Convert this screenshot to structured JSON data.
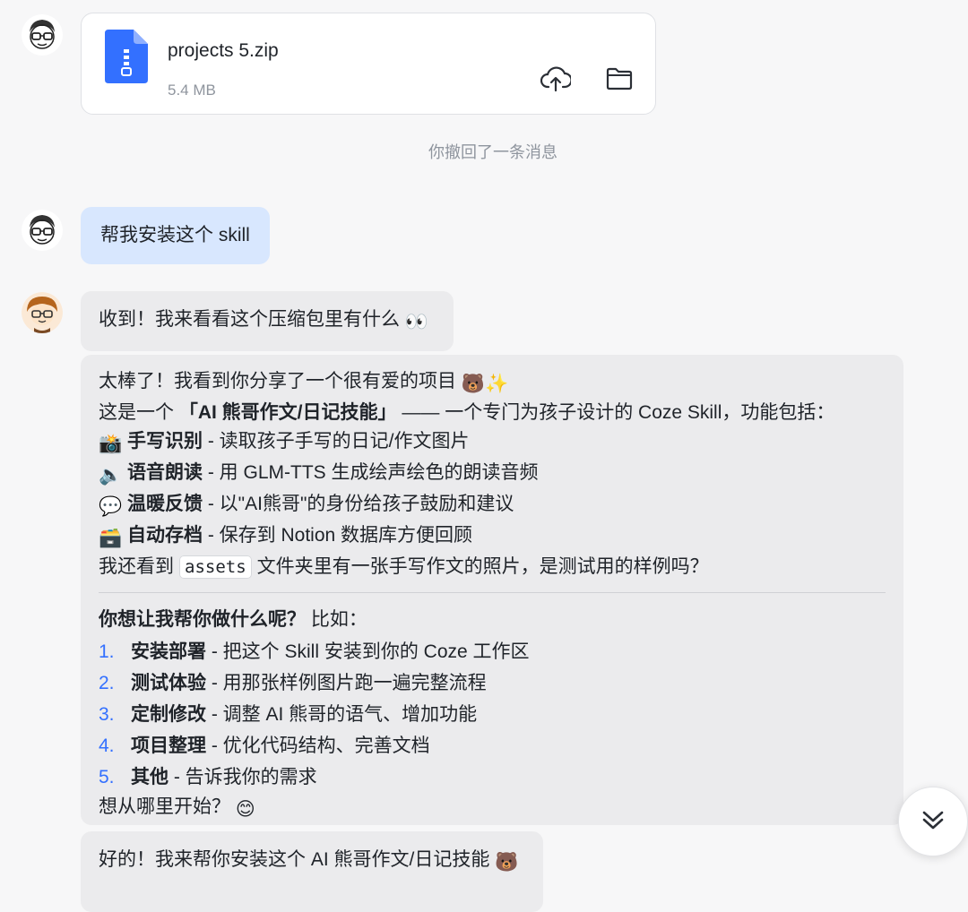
{
  "file_message": {
    "name": "projects 5.zip",
    "size": "5.4 MB",
    "icons": [
      "zip-file-icon",
      "cloud-upload-icon",
      "folder-icon"
    ]
  },
  "system_note": "你撤回了一条消息",
  "user_message": "帮我安装这个 skill",
  "ai_message_1": {
    "text": "收到！我来看看这个压缩包里有什么",
    "emoji": "👀"
  },
  "ai_message_2": {
    "line1_text": "太棒了！我看到你分享了一个很有爱的项目",
    "line1_emoji": "🐻✨",
    "line2_prefix": "这是一个",
    "line2_bold": "「AI 熊哥作文/日记技能」",
    "line2_suffix": "—— 一个专门为孩子设计的 Coze Skill，功能包括：",
    "features": [
      {
        "icon": "📸",
        "title": "手写识别",
        "desc": " - 读取孩子手写的日记/作文图片"
      },
      {
        "icon": "🔈",
        "title": "语音朗读",
        "desc": " - 用 GLM-TTS 生成绘声绘色的朗读音频"
      },
      {
        "icon": "💬",
        "title": "温暖反馈",
        "desc": " - 以\"AI熊哥\"的身份给孩子鼓励和建议"
      },
      {
        "icon": "🗃️",
        "title": "自动存档",
        "desc": " - 保存到 Notion 数据库方便回顾"
      }
    ],
    "assets_prefix": "我还看到",
    "assets_code": "assets",
    "assets_suffix": "文件夹里有一张手写作文的照片，是测试用的样例吗？",
    "question_bold": "你想让我帮你做什么呢？",
    "question_suffix": " 比如：",
    "options": [
      {
        "num": "1.",
        "title": "安装部署",
        "desc": " - 把这个 Skill 安装到你的 Coze 工作区"
      },
      {
        "num": "2.",
        "title": "测试体验",
        "desc": " - 用那张样例图片跑一遍完整流程"
      },
      {
        "num": "3.",
        "title": "定制修改",
        "desc": " - 调整 AI 熊哥的语气、增加功能"
      },
      {
        "num": "4.",
        "title": "项目整理",
        "desc": " - 优化代码结构、完善文档"
      },
      {
        "num": "5.",
        "title": "其他",
        "desc": " - 告诉我你的需求"
      }
    ],
    "closing": "想从哪里开始？",
    "closing_emoji": "😊"
  },
  "ai_message_3": {
    "text": "好的！我来帮你安装这个 AI 熊哥作文/日记技能",
    "emoji": "🐻"
  },
  "colors": {
    "user_bubble": "#d8e7fe",
    "ai_bubble": "#ebebed",
    "zip_icon": "#3370ff",
    "list_number": "#3370ff"
  }
}
